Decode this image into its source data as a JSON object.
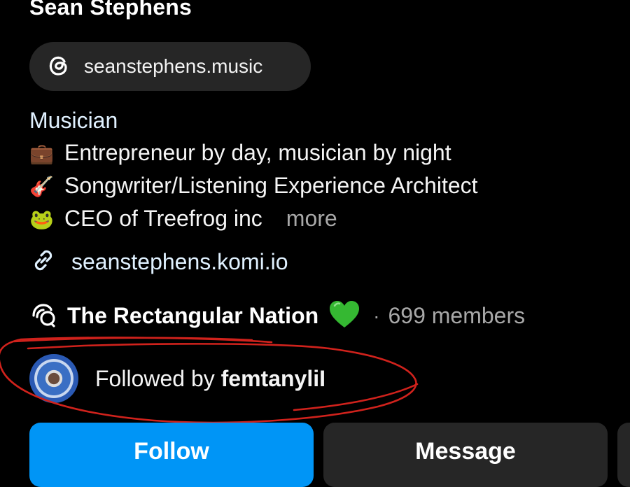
{
  "profile": {
    "name": "Sean Stephens",
    "threads_handle": "seanstephens.music",
    "category": "Musician",
    "bio": [
      {
        "emoji": "💼",
        "text": "Entrepreneur by day, musician by night"
      },
      {
        "emoji": "🎸",
        "text": "Songwriter/Listening Experience Architect"
      },
      {
        "emoji": "🐸",
        "text": "CEO of Treefrog inc"
      }
    ],
    "more_label": "more",
    "link": "seanstephens.komi.io"
  },
  "channel": {
    "title": "The Rectangular Nation",
    "emoji": "💚",
    "separator": "·",
    "members": "699 members"
  },
  "followed_by": {
    "prefix": "Followed by",
    "user": "femtanyliI"
  },
  "buttons": {
    "follow": "Follow",
    "message": "Message"
  },
  "colors": {
    "follow_button": "#0095f6",
    "secondary_button": "#262626",
    "annotation": "#d0221c"
  },
  "icons": {
    "threads": "threads-icon",
    "link": "link-icon",
    "channel": "broadcast-channel-icon"
  }
}
